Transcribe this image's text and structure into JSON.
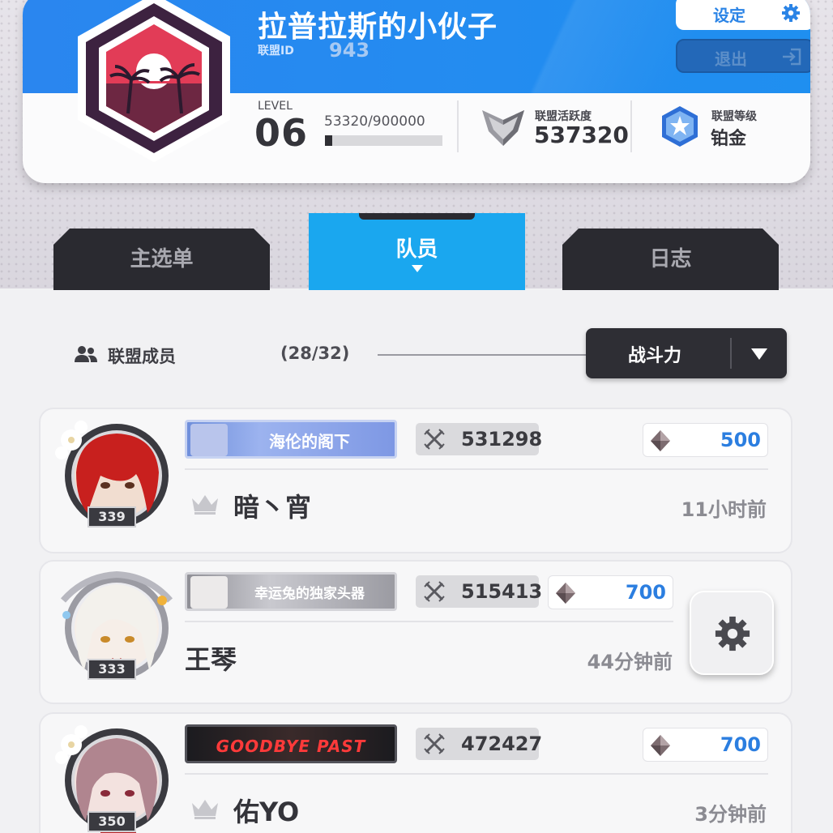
{
  "alliance": {
    "name": "拉普拉斯的小伙子",
    "id_label": "联盟ID",
    "id_value": "943",
    "level_label": "LEVEL",
    "level_value": "06",
    "exp_text": "53320/900000",
    "exp_progress": 0.0592,
    "activity_label": "联盟活跃度",
    "activity_value": "537320",
    "rank_label": "联盟等级",
    "rank_value": "铂金"
  },
  "buttons": {
    "settings_label": "设定",
    "exit_label": "退出"
  },
  "tabs": [
    {
      "label": "主选单",
      "active": false
    },
    {
      "label": "队员",
      "active": true
    },
    {
      "label": "日志",
      "active": false
    }
  ],
  "members_header": {
    "label": "联盟成员",
    "count": "(28/32)",
    "sort_label": "战斗力"
  },
  "members": [
    {
      "title_plate": "海伦的阁下",
      "power": "531298",
      "contribution": "500",
      "name": "暗丶宵",
      "last_seen": "11小时前",
      "avatar_level": "339",
      "is_leader": true
    },
    {
      "title_plate": "幸运兔的独家头器",
      "power": "515413",
      "contribution": "700",
      "name": "王琴",
      "last_seen": "44分钟前",
      "avatar_level": "333",
      "is_leader": false
    },
    {
      "title_plate": "GOODBYE PAST",
      "power": "472427",
      "contribution": "700",
      "name": "佑YO",
      "last_seen": "3分钟前",
      "avatar_level": "350",
      "is_leader": true
    }
  ],
  "icons": {
    "settings": "gear-icon",
    "exit": "exit-icon",
    "activity": "shield-chevron-icon",
    "rank": "star-hexagon-icon",
    "members": "people-icon",
    "power": "crossed-swords-icon",
    "contribution": "diamond-icon",
    "leader": "crown-icon",
    "member_settings": "gear-icon"
  },
  "colors": {
    "header_blue": "#238cf0",
    "active_tab": "#1aa7ef",
    "dark_tab": "#2a2a30",
    "contribution_blue": "#2b7ee0"
  }
}
